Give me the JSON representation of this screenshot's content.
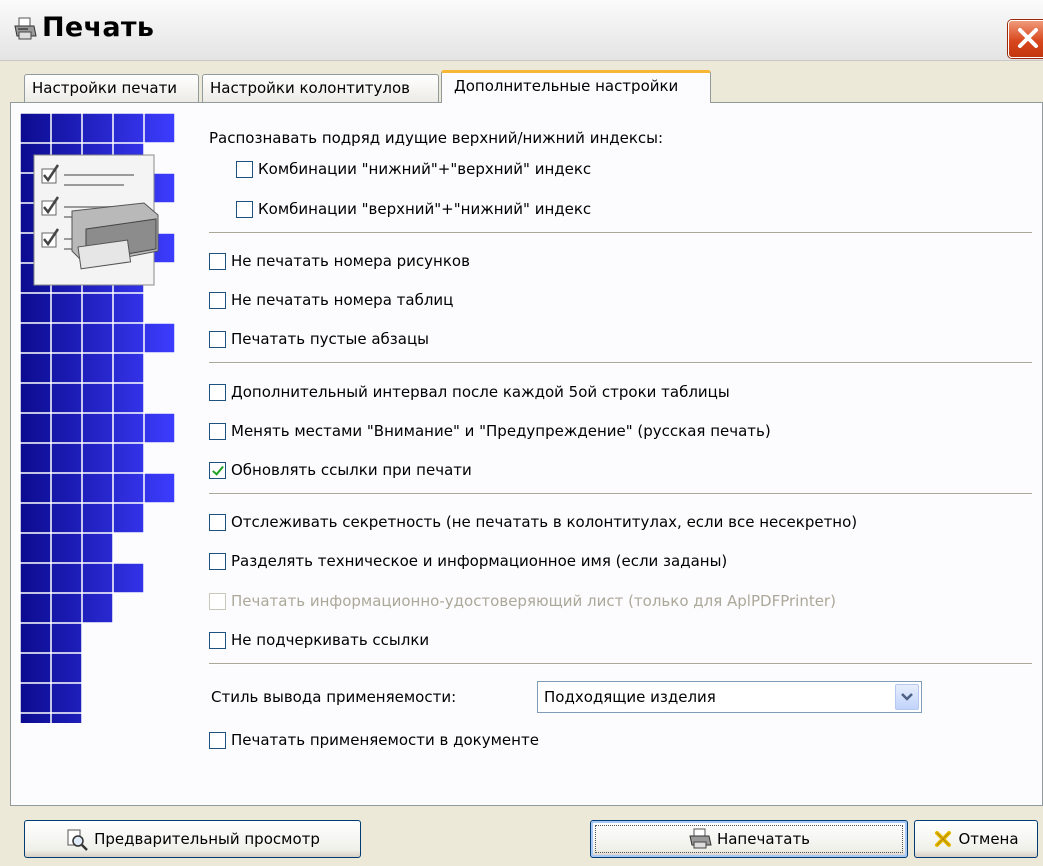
{
  "window": {
    "title": "Печать",
    "close_icon": "close-icon"
  },
  "tabs": [
    {
      "label": "Настройки печати",
      "active": false
    },
    {
      "label": "Настройки колонтитулов",
      "active": false
    },
    {
      "label": "Дополнительные настройки",
      "active": true
    }
  ],
  "options": {
    "index_heading": "Распознавать подряд идущие верхний/нижний индексы:",
    "sub_sup": {
      "label": "Комбинации \"нижний\"+\"верхний\" индекс",
      "checked": false
    },
    "sup_sub": {
      "label": "Комбинации \"верхний\"+\"нижний\" индекс",
      "checked": false
    },
    "no_figure_numbers": {
      "label": "Не печатать номера рисунков",
      "checked": false
    },
    "no_table_numbers": {
      "label": "Не печатать номера таблиц",
      "checked": false
    },
    "print_empty_paragraphs": {
      "label": "Печатать пустые абзацы",
      "checked": false
    },
    "extra_interval": {
      "label": "Дополнительный интервал после каждой 5ой строки таблицы",
      "checked": false
    },
    "swap_warnings": {
      "label": "Менять местами \"Внимание\" и \"Предупреждение\" (русская печать)",
      "checked": false
    },
    "update_links": {
      "label": "Обновлять ссылки при печати",
      "checked": true
    },
    "track_secrecy": {
      "label": "Отслеживать секретность (не печатать в колонтитулах, если все несекретно)",
      "checked": false
    },
    "separate_names": {
      "label": "Разделять техническое и информационное имя (если заданы)",
      "checked": false
    },
    "print_info_sheet": {
      "label": "Печатать информационно-удостоверяющий лист (только для AplPDFPrinter)",
      "checked": false,
      "disabled": true
    },
    "no_underline_links": {
      "label": "Не подчеркивать ссылки",
      "checked": false
    },
    "applicability_style_label": "Стиль вывода применяемости:",
    "applicability_style_value": "Подходящие изделия",
    "print_applicability": {
      "label": "Печатать применяемости в документе",
      "checked": false
    }
  },
  "buttons": {
    "preview": "Предварительный просмотр",
    "print": "Напечатать",
    "cancel": "Отмена"
  },
  "colors": {
    "tab_accent": "#f7b734",
    "banner_dark": "#0b0b8f",
    "banner_light": "#3d3dff",
    "check": "#21a121"
  }
}
